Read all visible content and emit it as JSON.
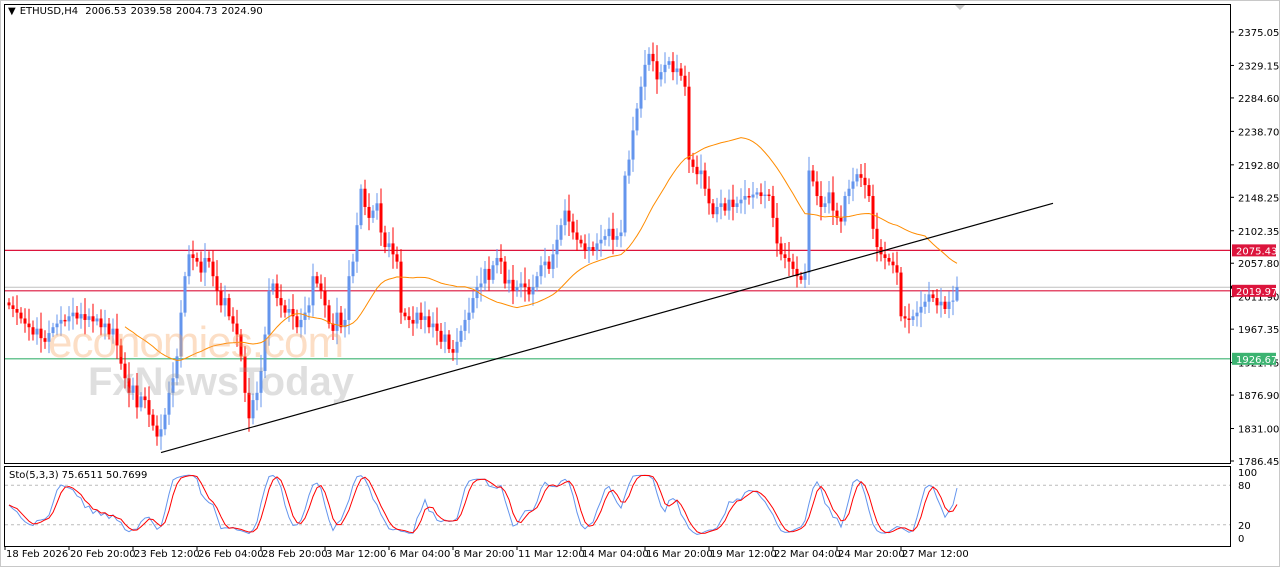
{
  "header": {
    "symbol": "ETHUSD,H4",
    "open": "2006.53",
    "high": "2039.58",
    "low": "2004.73",
    "close": "2024.90"
  },
  "watermark": {
    "line1": "economies.com",
    "line2": "FxNewsToday"
  },
  "colors": {
    "bull": "#6495ED",
    "bear": "#FF0000",
    "ma": "#FF8C00",
    "resistance": "#DC143C",
    "support": "#3CB371",
    "trendline": "#000000",
    "stoch_main": "#6495ED",
    "stoch_signal": "#FF0000",
    "bid_line": "#C0C0C0"
  },
  "chart_data": [
    {
      "type": "candlestick",
      "timeframe": "H4",
      "ylim": [
        1786.45,
        2375.05
      ],
      "y_ticks": [
        "2375.05",
        "2329.15",
        "2284.60",
        "2238.70",
        "2192.80",
        "2148.25",
        "2102.35",
        "2057.80",
        "2011.90",
        "1967.35",
        "1921.45",
        "1876.90",
        "1831.00",
        "1786.45"
      ],
      "x_ticks": [
        "18 Feb 2026",
        "20 Feb 20:00",
        "23 Feb 12:00",
        "26 Feb 04:00",
        "28 Feb 20:00",
        "3 Mar 12:00",
        "6 Mar 04:00",
        "8 Mar 20:00",
        "11 Mar 12:00",
        "14 Mar 04:00",
        "16 Mar 20:00",
        "19 Mar 12:00",
        "22 Mar 04:00",
        "24 Mar 20:00",
        "27 Mar 12:00"
      ],
      "last_candle": {
        "open": 2006.53,
        "high": 2039.58,
        "low": 2004.73,
        "close": 2024.9
      },
      "closes": [
        2000,
        1995,
        1990,
        1982,
        1975,
        1970,
        1960,
        1968,
        1955,
        1950,
        1962,
        1970,
        1975,
        1980,
        1978,
        1985,
        1990,
        1982,
        1988,
        1980,
        1985,
        1978,
        1982,
        1970,
        1975,
        1960,
        1968,
        1945,
        1920,
        1900,
        1880,
        1890,
        1860,
        1875,
        1870,
        1850,
        1835,
        1820,
        1830,
        1850,
        1880,
        1900,
        1930,
        1990,
        2040,
        2070,
        2065,
        2060,
        2045,
        2065,
        2060,
        2040,
        2020,
        2000,
        2010,
        1985,
        1975,
        1960,
        1930,
        1880,
        1845,
        1870,
        1880,
        1910,
        1960,
        2020,
        2030,
        2010,
        2000,
        1990,
        1995,
        1985,
        1970,
        1980,
        1990,
        2000,
        2040,
        2030,
        2020,
        2000,
        1975,
        1965,
        1990,
        1970,
        1980,
        2040,
        2060,
        2110,
        2160,
        2135,
        2120,
        2130,
        2140,
        2100,
        2080,
        2085,
        2070,
        2060,
        1990,
        1985,
        1980,
        1975,
        1990,
        1980,
        1985,
        1970,
        1975,
        1965,
        1950,
        1960,
        1940,
        1935,
        1950,
        1965,
        1980,
        1990,
        2010,
        2025,
        2030,
        2050,
        2035,
        2055,
        2065,
        2060,
        2030,
        2035,
        2020,
        2025,
        2030,
        2025,
        2015,
        2025,
        2040,
        2055,
        2060,
        2050,
        2070,
        2090,
        2110,
        2130,
        2115,
        2100,
        2090,
        2085,
        2075,
        2080,
        2075,
        2085,
        2090,
        2095,
        2105,
        2090,
        2095,
        2100,
        2178,
        2200,
        2240,
        2270,
        2300,
        2330,
        2345,
        2335,
        2310,
        2320,
        2330,
        2335,
        2320,
        2325,
        2315,
        2300,
        2200,
        2190,
        2180,
        2185,
        2160,
        2140,
        2125,
        2135,
        2140,
        2130,
        2145,
        2135,
        2140,
        2145,
        2150,
        2148,
        2152,
        2155,
        2150,
        2152,
        2150,
        2120,
        2085,
        2070,
        2065,
        2060,
        2050,
        2040,
        2035,
        2045,
        2185,
        2170,
        2150,
        2135,
        2140,
        2155,
        2130,
        2120,
        2115,
        2150,
        2160,
        2170,
        2180,
        2175,
        2165,
        2150,
        2105,
        2080,
        2070,
        2065,
        2060,
        2055,
        2045,
        1985,
        1982,
        1980,
        1985,
        1990,
        1998,
        2005,
        2015,
        2010,
        2000,
        2005,
        1995,
        2005,
        2006.53,
        2024.9
      ],
      "horizontal_levels": [
        {
          "price": "2075.43",
          "role": "resistance"
        },
        {
          "price": "2019.97",
          "role": "resistance"
        },
        {
          "price": "1926.67",
          "role": "support"
        }
      ],
      "trendline": {
        "from_bar": 38,
        "from_price": 1798,
        "to_bar": 261,
        "to_price": 2140
      },
      "moving_average": true,
      "grid": false
    },
    {
      "type": "line",
      "indicator": "Stochastic",
      "label": "Sto(5,3,3)",
      "main_value": "75.6511",
      "signal_value": "50.7699",
      "ylim": [
        0,
        100
      ],
      "y_ticks": [
        "100",
        "80",
        "20",
        "0"
      ],
      "levels": [
        80,
        20
      ]
    }
  ]
}
